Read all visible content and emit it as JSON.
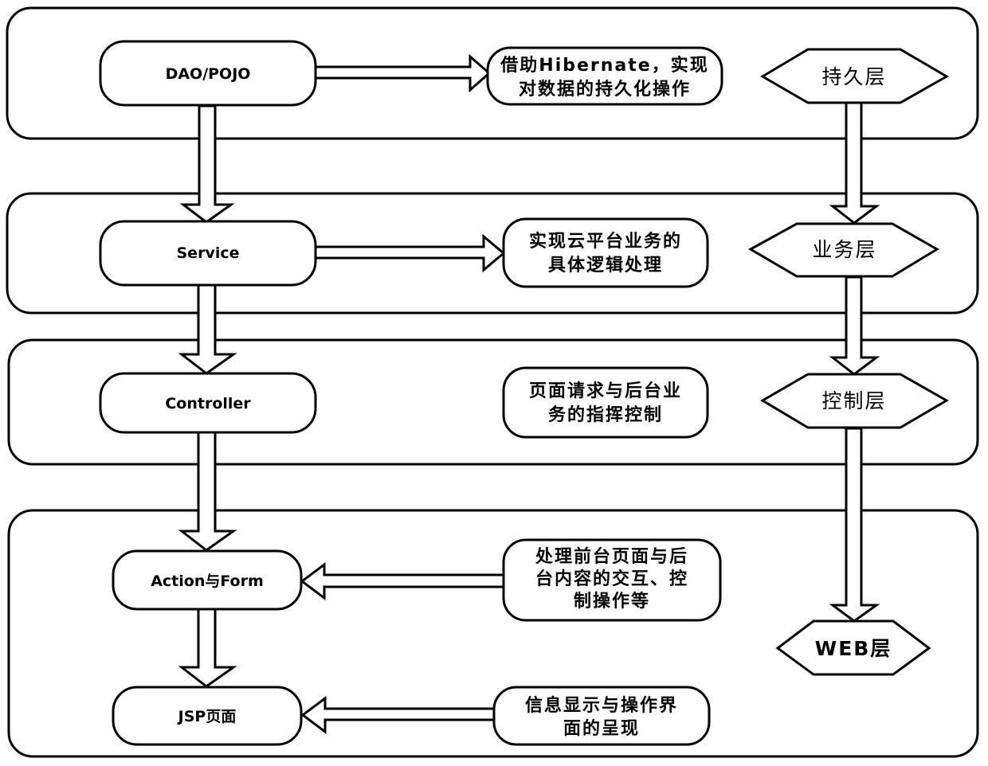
{
  "diagram": {
    "layers": [
      {
        "id": "persistence",
        "layer_label": "持久层",
        "node_label": "DAO/POJO",
        "description_lines": [
          "借助Hibernate，实现",
          "对数据的持久化操作"
        ],
        "description_arrow": "right"
      },
      {
        "id": "business",
        "layer_label": "业务层",
        "node_label": "Service",
        "description_lines": [
          "实现云平台业务的",
          "具体逻辑处理"
        ],
        "description_arrow": "right"
      },
      {
        "id": "control",
        "layer_label": "控制层",
        "node_label": "Controller",
        "description_lines": [
          "页面请求与后台业",
          "务的指挥控制"
        ],
        "description_arrow": "none"
      },
      {
        "id": "web",
        "layer_label": "WEB层",
        "nodes": [
          {
            "node_label": "Action与Form",
            "description_lines": [
              "处理前台页面与后",
              "台内容的交互、控",
              "制操作等"
            ],
            "description_arrow": "left"
          },
          {
            "node_label": "JSP页面",
            "description_lines": [
              "信息显示与操作界",
              "面的呈现"
            ],
            "description_arrow": "left"
          }
        ]
      }
    ],
    "flow": [
      "DAO/POJO",
      "Service",
      "Controller",
      "Action与Form",
      "JSP页面"
    ],
    "layer_flow": [
      "持久层",
      "业务层",
      "控制层",
      "WEB层"
    ]
  }
}
